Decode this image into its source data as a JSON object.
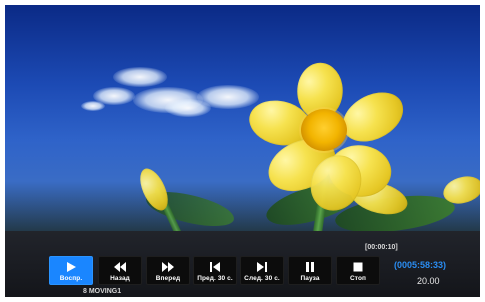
{
  "player": {
    "buttons": [
      {
        "label": "Воспр.",
        "icon": "play-icon",
        "active": true
      },
      {
        "label": "Назад",
        "icon": "rewind-icon",
        "active": false
      },
      {
        "label": "Вперед",
        "icon": "fast-forward-icon",
        "active": false
      },
      {
        "label": "Пред. 30 с.",
        "icon": "skip-back-icon",
        "active": false
      },
      {
        "label": "След. 30 с.",
        "icon": "skip-forward-icon",
        "active": false
      },
      {
        "label": "Пауза",
        "icon": "pause-icon",
        "active": false
      },
      {
        "label": "Стоп",
        "icon": "stop-icon",
        "active": false
      }
    ],
    "current_time": "[00:00:10]",
    "total_time": "(0005:58:33)",
    "speed": "20.00",
    "filename": "8 MOVING1"
  },
  "colors": {
    "active_button": "#1a86ff",
    "button": "#0c0c0c",
    "total_time": "#2a8df2"
  }
}
